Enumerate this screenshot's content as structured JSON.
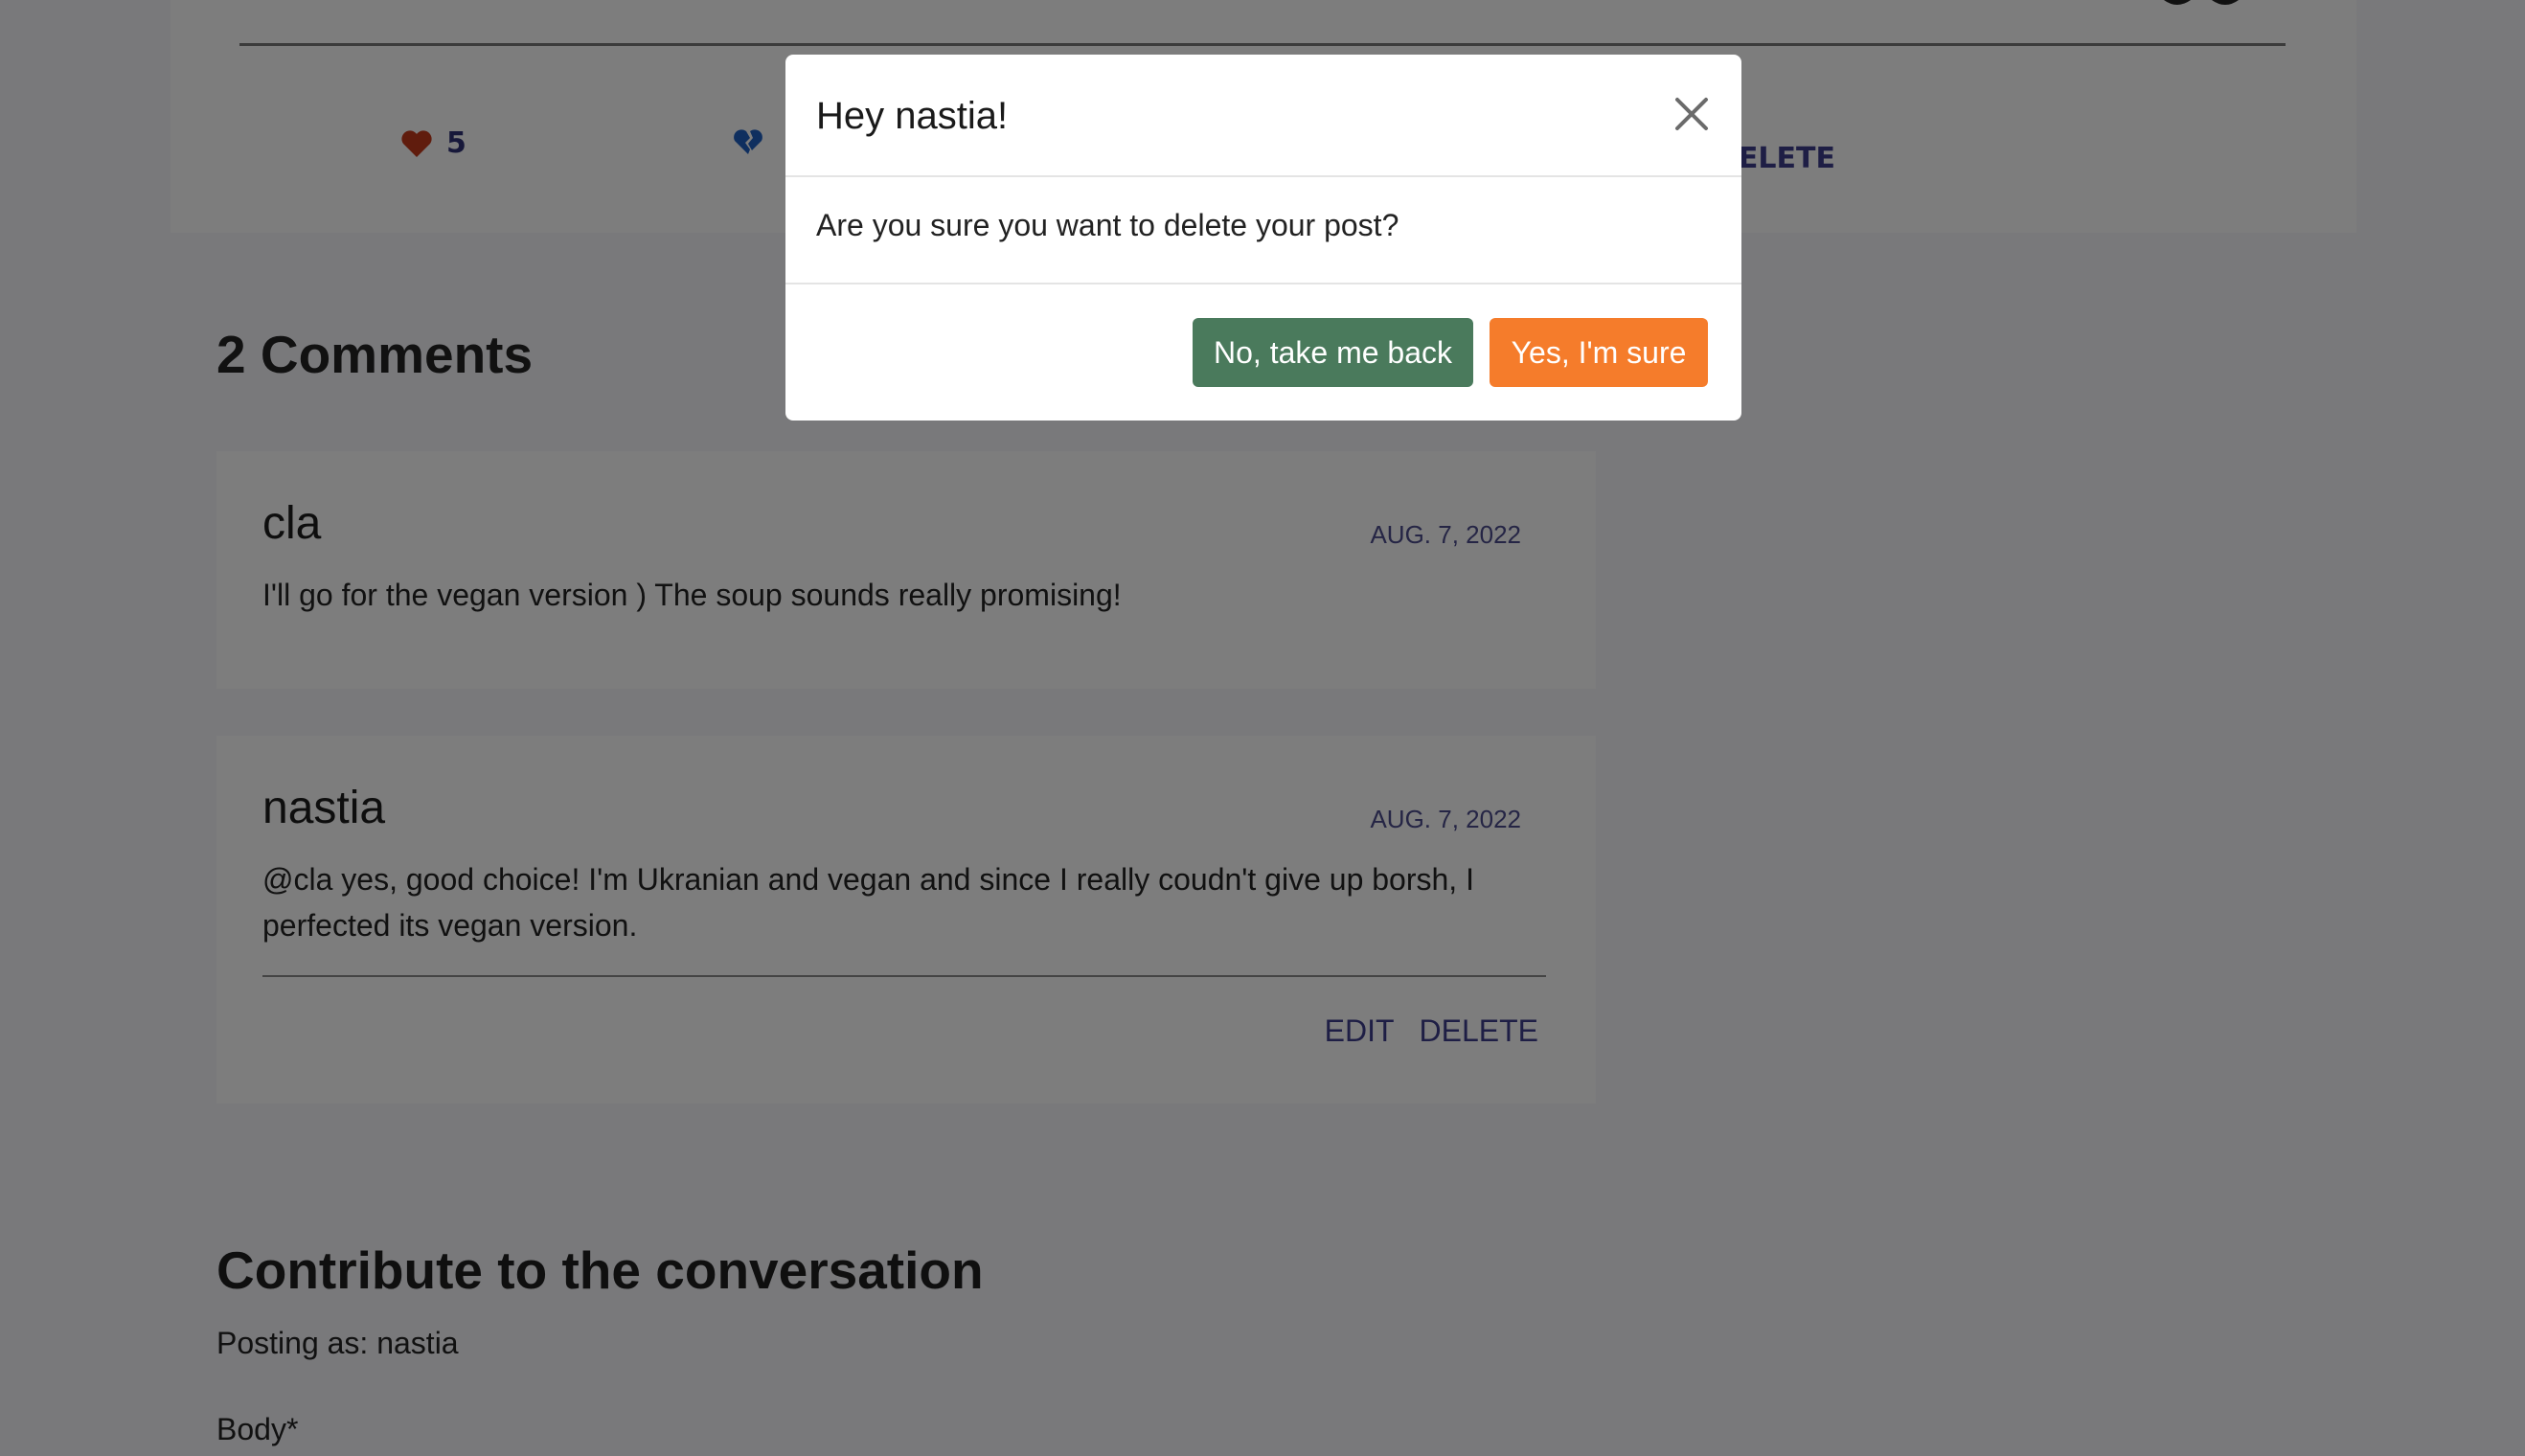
{
  "post": {
    "likes_count": "5",
    "delete_label": "DELETE"
  },
  "comments": {
    "title": "2 Comments",
    "items": [
      {
        "author": "cla",
        "date": "AUG. 7, 2022",
        "body": "I'll go for the vegan version ) The soup sounds really promising!"
      },
      {
        "author": "nastia",
        "date": "AUG. 7, 2022",
        "body": "@cla yes, good choice! I'm Ukranian and vegan and since I really coudn't give up borsh, I perfected its vegan version.",
        "edit_label": "EDIT",
        "delete_label": "DELETE"
      }
    ]
  },
  "contribute": {
    "title": "Contribute to the conversation",
    "posting_as": "Posting as: nastia",
    "body_label": "Body*"
  },
  "modal": {
    "title": "Hey nastia!",
    "message": "Are you sure you want to delete your post?",
    "cancel_label": "No, take me back",
    "confirm_label": "Yes, I'm sure"
  },
  "colors": {
    "like_heart": "#c0391b",
    "dislike_heart": "#1f5fbf",
    "cancel_button": "#4a7a5c",
    "confirm_button": "#f57c2b",
    "link_text": "#3c3c8a"
  },
  "icons": [
    "heart-icon",
    "broken-heart-icon",
    "close-icon"
  ]
}
